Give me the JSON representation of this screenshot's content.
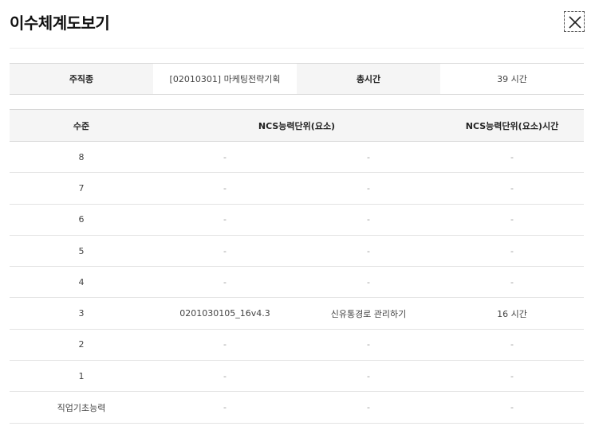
{
  "dialog": {
    "title": "이수체계도보기",
    "close_icon": "close-icon"
  },
  "summary": {
    "job_label": "주직종",
    "job_value": "[02010301] 마케팅전략기획",
    "time_label": "총시간",
    "time_value": "39 시간"
  },
  "grid": {
    "headers": {
      "level": "수준",
      "unit": "NCS능력단위(요소)",
      "hours": "NCS능력단위(요소)시간"
    },
    "rows": [
      {
        "level": "8",
        "code": "-",
        "name": "-",
        "hours": "-"
      },
      {
        "level": "7",
        "code": "-",
        "name": "-",
        "hours": "-"
      },
      {
        "level": "6",
        "code": "-",
        "name": "-",
        "hours": "-"
      },
      {
        "level": "5",
        "code": "-",
        "name": "-",
        "hours": "-"
      },
      {
        "level": "4",
        "code": "-",
        "name": "-",
        "hours": "-"
      },
      {
        "level": "3",
        "code": "0201030105_16v4.3",
        "name": "신유통경로 관리하기",
        "hours": "16 시간"
      },
      {
        "level": "2",
        "code": "-",
        "name": "-",
        "hours": "-"
      },
      {
        "level": "1",
        "code": "-",
        "name": "-",
        "hours": "-"
      },
      {
        "level": "직업기초능력",
        "code": "-",
        "name": "-",
        "hours": "-"
      }
    ]
  }
}
